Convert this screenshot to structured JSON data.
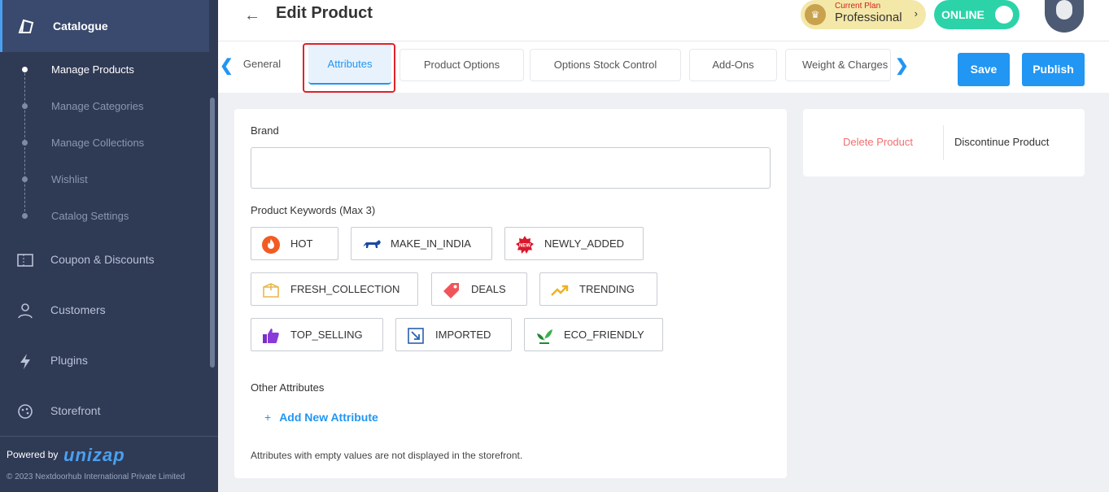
{
  "sidebar": {
    "header": "Catalogue",
    "subitems": [
      "Manage Products",
      "Manage Categories",
      "Manage Collections",
      "Wishlist",
      "Catalog Settings"
    ],
    "items": [
      "Coupon & Discounts",
      "Customers",
      "Plugins",
      "Storefront"
    ],
    "powered_by": "Powered by",
    "logo": "unizap",
    "copyright": "© 2023 Nextdoorhub International Private Limited"
  },
  "header": {
    "back_icon": "arrow-left-icon",
    "title": "Edit Product",
    "plan_label": "Current Plan",
    "plan_name": "Professional",
    "status": "ONLINE"
  },
  "tabs": [
    "General",
    "Attributes",
    "Product Options",
    "Options Stock Control",
    "Add-Ons",
    "Weight & Charges"
  ],
  "active_tab": "Attributes",
  "actions": {
    "save": "Save",
    "publish": "Publish"
  },
  "attributes": {
    "brand_label": "Brand",
    "brand_value": "",
    "keywords_label": "Product Keywords (Max 3)",
    "keywords": [
      {
        "label": "HOT",
        "icon": "fire-icon"
      },
      {
        "label": "MAKE_IN_INDIA",
        "icon": "lion-icon"
      },
      {
        "label": "NEWLY_ADDED",
        "icon": "new-badge-icon"
      },
      {
        "label": "FRESH_COLLECTION",
        "icon": "box-icon"
      },
      {
        "label": "DEALS",
        "icon": "tag-icon"
      },
      {
        "label": "TRENDING",
        "icon": "trend-up-icon"
      },
      {
        "label": "TOP_SELLING",
        "icon": "thumbs-up-icon"
      },
      {
        "label": "IMPORTED",
        "icon": "import-icon"
      },
      {
        "label": "ECO_FRIENDLY",
        "icon": "leaf-icon"
      }
    ],
    "other_label": "Other Attributes",
    "add_new": "Add New Attribute",
    "add_icon": "+",
    "note": "Attributes with empty values are not displayed in the storefront."
  },
  "side_actions": {
    "delete": "Delete Product",
    "discontinue": "Discontinue Product"
  },
  "colors": {
    "accent": "#2196f3",
    "sidebar": "#2f3a55",
    "online": "#2cd3a8",
    "danger": "#f07070"
  }
}
